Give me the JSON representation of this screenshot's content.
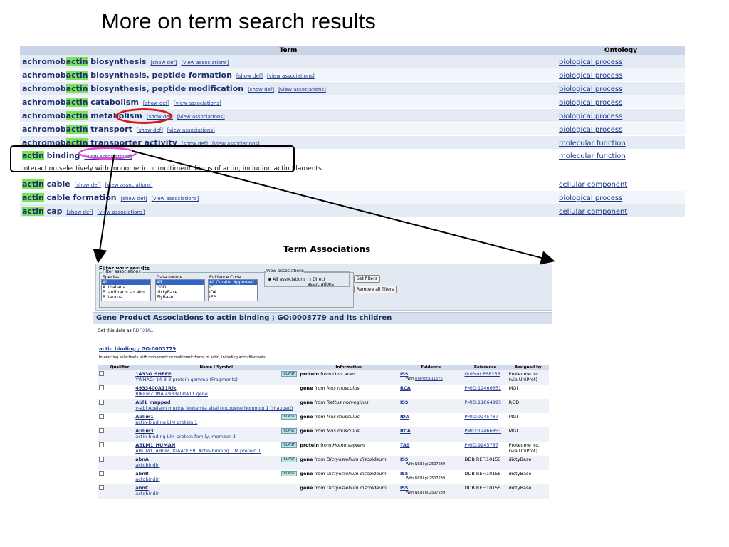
{
  "slide": {
    "title": "More on term search results"
  },
  "term_table": {
    "headers": {
      "term": "Term",
      "ontology": "Ontology"
    },
    "show_def": "[show def]",
    "view_assoc": "[view associations]",
    "rows": [
      {
        "prefix": "achromob",
        "hl": "actin",
        "rest": " biosynthesis",
        "ontology": "biological process"
      },
      {
        "prefix": "achromob",
        "hl": "actin",
        "rest": " biosynthesis, peptide formation",
        "ontology": "biological process"
      },
      {
        "prefix": "achromob",
        "hl": "actin",
        "rest": " biosynthesis, peptide modification",
        "ontology": "biological process"
      },
      {
        "prefix": "achromob",
        "hl": "actin",
        "rest": " catabolism",
        "ontology": "biological process"
      },
      {
        "prefix": "achromob",
        "hl": "actin",
        "rest": " metabolism",
        "ontology": "biological process"
      },
      {
        "prefix": "achromob",
        "hl": "actin",
        "rest": " transport",
        "ontology": "biological process"
      },
      {
        "prefix": "achromob",
        "hl": "actin",
        "rest": " transporter activity",
        "ontology": "molecular function"
      },
      {
        "prefix": "",
        "hl": "actin",
        "rest": " binding",
        "ontology": "molecular function",
        "definition": "Interacting selectively with monomeric or multimeric forms of actin, including actin filaments."
      },
      {
        "prefix": "",
        "hl": "actin",
        "rest": " cable",
        "ontology": "cellular component"
      },
      {
        "prefix": "",
        "hl": "actin",
        "rest": " cable formation",
        "ontology": "biological process"
      },
      {
        "prefix": "",
        "hl": "actin",
        "rest": " cap",
        "ontology": "cellular component"
      }
    ]
  },
  "assoc": {
    "title": "Term Associations",
    "filter": {
      "title": "Filter your results",
      "legend": "Filter associations",
      "species_label": "Species",
      "species": [
        "All",
        "A. thaliana",
        "B. anthracis str. Am",
        "B. taurus"
      ],
      "source_label": "Data source",
      "sources": [
        "All",
        "CGD",
        "dictyBase",
        "FlyBase"
      ],
      "evidence_label": "Evidence Code",
      "evidence": [
        "All Curator Approved",
        "IC",
        "IDA",
        "IEP"
      ],
      "view_legend": "View associations",
      "all_assoc": "All associations",
      "direct_assoc": "Direct associations",
      "set_filters": "Set filters",
      "remove_filters": "Remove all filters"
    },
    "panel_title": "Gene Product Associations to actin binding ; GO:0003779 and its children",
    "rdf_prefix": "Get this data as ",
    "rdf_link": "RDF-XML",
    "rdf_suffix": ".",
    "term_link": "actin binding ; GO:0003779",
    "term_def": "Interacting selectively with monomeric or multimeric forms of actin, including actin filaments.",
    "columns": [
      "Qualifier",
      "Name / Symbol",
      "Information",
      "Evidence",
      "Reference",
      "Assigned by"
    ],
    "blast": "BLAST",
    "rows": [
      {
        "sym": "1433G_SHEEP",
        "name": "YWHAG: 14-3-3 protein gamma (Fragments)",
        "blast": true,
        "kind": "protein",
        "from": " from ",
        "species": "Ovis aries",
        "ev": "ISS",
        "with_prefix": "With ",
        "with": "UniProt:P11576",
        "ref": "UniProt:P68253",
        "by": "Proteome Inc. (via UniProt)"
      },
      {
        "sym": "4933400A11Rik",
        "name": "RIKEN cDNA 4933400A11 gene",
        "blast": false,
        "kind": "gene",
        "from": " from ",
        "species": "Mus musculus",
        "ev": "RCA",
        "with_prefix": "",
        "with": "",
        "ref": "PMID:12466851",
        "by": "MGI"
      },
      {
        "sym": "Abl1_mapped",
        "name": "v-abl Abelson murine leukemia viral oncogene homolog 1 (mapped)",
        "blast": false,
        "kind": "gene",
        "from": " from ",
        "species": "Rattus norvegicus",
        "ev": "ISS",
        "with_prefix": "",
        "with": "",
        "ref": "PMID:11864995",
        "by": "RGD"
      },
      {
        "sym": "Ablim1",
        "name": "actin-binding LIM protein 1",
        "blast": true,
        "kind": "gene",
        "from": " from ",
        "species": "Mus musculus",
        "ev": "IDA",
        "with_prefix": "",
        "with": "",
        "ref": "PMID:9245787",
        "by": "MGI"
      },
      {
        "sym": "Ablim3",
        "name": "actin binding LIM protein family, member 3",
        "blast": true,
        "kind": "gene",
        "from": " from ",
        "species": "Mus musculus",
        "ev": "RCA",
        "with_prefix": "",
        "with": "",
        "ref": "PMID:12466851",
        "by": "MGI"
      },
      {
        "sym": "ABLM1_HUMAN",
        "name": "ABLIM1, ABLIM, KIAA0059: Actin-binding LIM protein 1",
        "blast": true,
        "kind": "protein",
        "from": " from ",
        "species": "Homo sapiens",
        "ev": "TAS",
        "with_prefix": "",
        "with": "",
        "ref": "PMID:9245787",
        "by": "Proteome Inc. (via UniProt)"
      },
      {
        "sym": "abnA",
        "name": "actobindin",
        "blast": true,
        "kind": "gene",
        "from": " from ",
        "species": "Dictyostelium discoideum",
        "ev": "ISS",
        "with_prefix": "",
        "with": "With NCBI gi:2507239",
        "ref": "DDB REF:10155",
        "by": "dictyBase"
      },
      {
        "sym": "abnB",
        "name": "actobindin",
        "blast": true,
        "kind": "gene",
        "from": " from ",
        "species": "Dictyostelium discoideum",
        "ev": "ISS",
        "with_prefix": "",
        "with": "With NCBI gi:2507239",
        "ref": "DDB REF:10155",
        "by": "dictyBase"
      },
      {
        "sym": "abnC",
        "name": "actobindin",
        "blast": false,
        "kind": "gene",
        "from": " from ",
        "species": "Dictyostelium discoideum",
        "ev": "ISS",
        "with_prefix": "",
        "with": "With NCBI gi:2507239",
        "ref": "DDB REF:10155",
        "by": "dictyBase"
      }
    ]
  },
  "colors": {
    "highlight": "#7be35a",
    "header": "#c9d5e6",
    "red_oval": "#d51c1c",
    "pink_oval": "#e14be0",
    "link": "#1f3a8a"
  }
}
